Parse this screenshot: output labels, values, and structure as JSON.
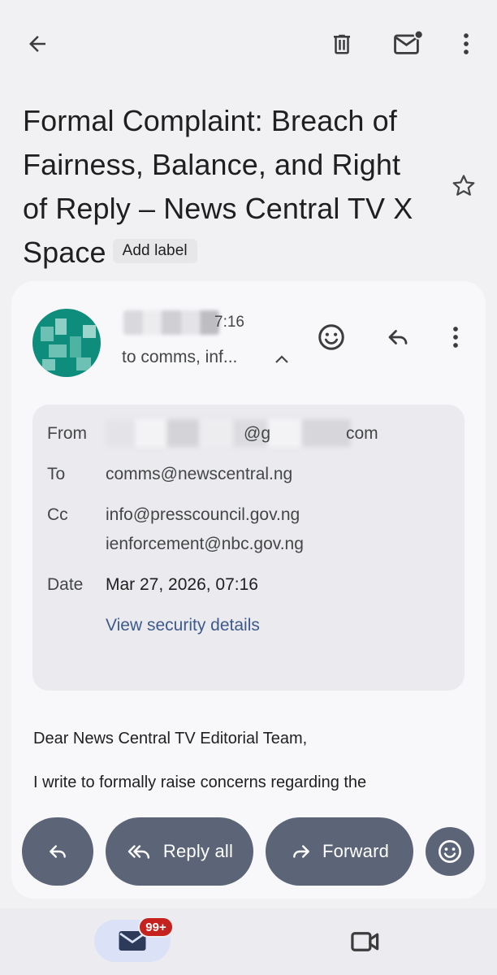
{
  "toolbar": {
    "back_icon": "arrow-left-icon",
    "delete_icon": "trash-icon",
    "mark_unread_icon": "mail-unread-icon",
    "more_icon": "more-vertical-icon"
  },
  "email": {
    "subject_lines": [
      "Formal Complaint: Breach of",
      "Fairness, Balance, and Right",
      "of Reply – News Central TV X",
      "Space"
    ],
    "add_label": "Add label",
    "star_icon": "star-outline-icon",
    "sender_time": "7:16",
    "to_summary": "to comms, inf...",
    "details": {
      "from_label": "From",
      "from_value": "com",
      "from_partial": "@g",
      "to_label": "To",
      "to_value": "comms@newscentral.ng",
      "cc_label": "Cc",
      "cc_values": [
        "info@presscouncil.gov.ng",
        "ienforcement@nbc.gov.ng"
      ],
      "date_label": "Date",
      "date_value": "Mar 27, 2026, 07:16",
      "security_link": "View security details"
    },
    "body": [
      "Dear News Central TV Editorial Team,",
      "I write to formally raise concerns regarding the"
    ]
  },
  "actions": {
    "reply_icon": "reply-icon",
    "reply_all_label": "Reply all",
    "forward_label": "Forward",
    "emoji_icon": "emoji-icon"
  },
  "bottom_nav": {
    "mail_badge": "99+",
    "mail_icon": "mail-icon",
    "meet_icon": "video-camera-icon"
  },
  "colors": {
    "background": "#f1f1f4",
    "card": "#f8f8fb",
    "details_box": "#ebebef",
    "pill": "#5c6578",
    "link": "#3d5a8c",
    "badge": "#c5221f",
    "avatar": "#0f8d7c"
  }
}
